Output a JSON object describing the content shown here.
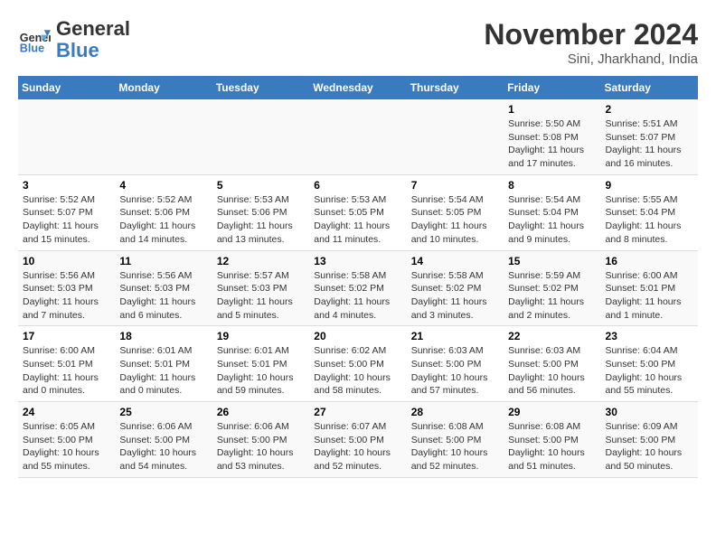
{
  "header": {
    "logo_line1": "General",
    "logo_line2": "Blue",
    "month_title": "November 2024",
    "location": "Sini, Jharkhand, India"
  },
  "weekdays": [
    "Sunday",
    "Monday",
    "Tuesday",
    "Wednesday",
    "Thursday",
    "Friday",
    "Saturday"
  ],
  "weeks": [
    [
      {
        "day": "",
        "info": ""
      },
      {
        "day": "",
        "info": ""
      },
      {
        "day": "",
        "info": ""
      },
      {
        "day": "",
        "info": ""
      },
      {
        "day": "",
        "info": ""
      },
      {
        "day": "1",
        "info": "Sunrise: 5:50 AM\nSunset: 5:08 PM\nDaylight: 11 hours and 17 minutes."
      },
      {
        "day": "2",
        "info": "Sunrise: 5:51 AM\nSunset: 5:07 PM\nDaylight: 11 hours and 16 minutes."
      }
    ],
    [
      {
        "day": "3",
        "info": "Sunrise: 5:52 AM\nSunset: 5:07 PM\nDaylight: 11 hours and 15 minutes."
      },
      {
        "day": "4",
        "info": "Sunrise: 5:52 AM\nSunset: 5:06 PM\nDaylight: 11 hours and 14 minutes."
      },
      {
        "day": "5",
        "info": "Sunrise: 5:53 AM\nSunset: 5:06 PM\nDaylight: 11 hours and 13 minutes."
      },
      {
        "day": "6",
        "info": "Sunrise: 5:53 AM\nSunset: 5:05 PM\nDaylight: 11 hours and 11 minutes."
      },
      {
        "day": "7",
        "info": "Sunrise: 5:54 AM\nSunset: 5:05 PM\nDaylight: 11 hours and 10 minutes."
      },
      {
        "day": "8",
        "info": "Sunrise: 5:54 AM\nSunset: 5:04 PM\nDaylight: 11 hours and 9 minutes."
      },
      {
        "day": "9",
        "info": "Sunrise: 5:55 AM\nSunset: 5:04 PM\nDaylight: 11 hours and 8 minutes."
      }
    ],
    [
      {
        "day": "10",
        "info": "Sunrise: 5:56 AM\nSunset: 5:03 PM\nDaylight: 11 hours and 7 minutes."
      },
      {
        "day": "11",
        "info": "Sunrise: 5:56 AM\nSunset: 5:03 PM\nDaylight: 11 hours and 6 minutes."
      },
      {
        "day": "12",
        "info": "Sunrise: 5:57 AM\nSunset: 5:03 PM\nDaylight: 11 hours and 5 minutes."
      },
      {
        "day": "13",
        "info": "Sunrise: 5:58 AM\nSunset: 5:02 PM\nDaylight: 11 hours and 4 minutes."
      },
      {
        "day": "14",
        "info": "Sunrise: 5:58 AM\nSunset: 5:02 PM\nDaylight: 11 hours and 3 minutes."
      },
      {
        "day": "15",
        "info": "Sunrise: 5:59 AM\nSunset: 5:02 PM\nDaylight: 11 hours and 2 minutes."
      },
      {
        "day": "16",
        "info": "Sunrise: 6:00 AM\nSunset: 5:01 PM\nDaylight: 11 hours and 1 minute."
      }
    ],
    [
      {
        "day": "17",
        "info": "Sunrise: 6:00 AM\nSunset: 5:01 PM\nDaylight: 11 hours and 0 minutes."
      },
      {
        "day": "18",
        "info": "Sunrise: 6:01 AM\nSunset: 5:01 PM\nDaylight: 11 hours and 0 minutes."
      },
      {
        "day": "19",
        "info": "Sunrise: 6:01 AM\nSunset: 5:01 PM\nDaylight: 10 hours and 59 minutes."
      },
      {
        "day": "20",
        "info": "Sunrise: 6:02 AM\nSunset: 5:00 PM\nDaylight: 10 hours and 58 minutes."
      },
      {
        "day": "21",
        "info": "Sunrise: 6:03 AM\nSunset: 5:00 PM\nDaylight: 10 hours and 57 minutes."
      },
      {
        "day": "22",
        "info": "Sunrise: 6:03 AM\nSunset: 5:00 PM\nDaylight: 10 hours and 56 minutes."
      },
      {
        "day": "23",
        "info": "Sunrise: 6:04 AM\nSunset: 5:00 PM\nDaylight: 10 hours and 55 minutes."
      }
    ],
    [
      {
        "day": "24",
        "info": "Sunrise: 6:05 AM\nSunset: 5:00 PM\nDaylight: 10 hours and 55 minutes."
      },
      {
        "day": "25",
        "info": "Sunrise: 6:06 AM\nSunset: 5:00 PM\nDaylight: 10 hours and 54 minutes."
      },
      {
        "day": "26",
        "info": "Sunrise: 6:06 AM\nSunset: 5:00 PM\nDaylight: 10 hours and 53 minutes."
      },
      {
        "day": "27",
        "info": "Sunrise: 6:07 AM\nSunset: 5:00 PM\nDaylight: 10 hours and 52 minutes."
      },
      {
        "day": "28",
        "info": "Sunrise: 6:08 AM\nSunset: 5:00 PM\nDaylight: 10 hours and 52 minutes."
      },
      {
        "day": "29",
        "info": "Sunrise: 6:08 AM\nSunset: 5:00 PM\nDaylight: 10 hours and 51 minutes."
      },
      {
        "day": "30",
        "info": "Sunrise: 6:09 AM\nSunset: 5:00 PM\nDaylight: 10 hours and 50 minutes."
      }
    ]
  ]
}
